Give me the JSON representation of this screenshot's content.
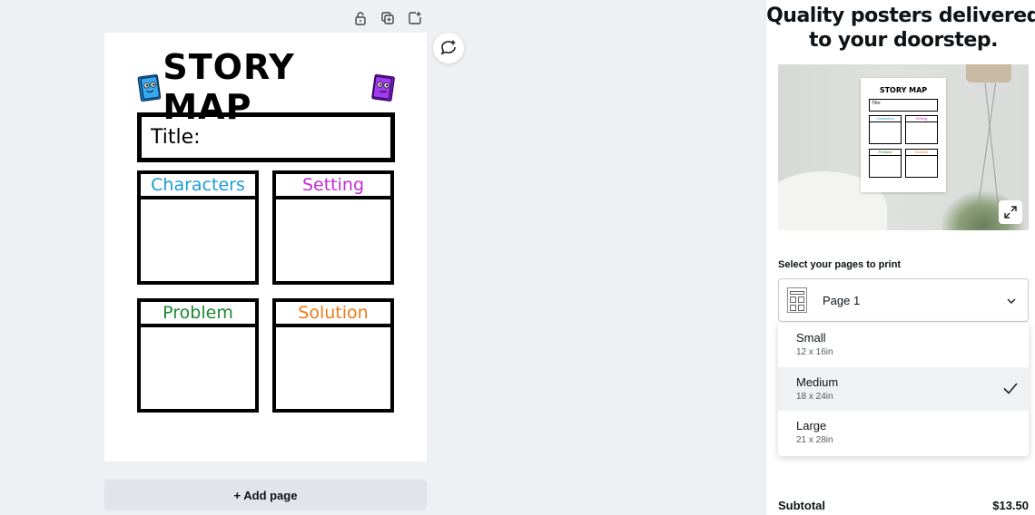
{
  "page": {
    "add_page_label": "+ Add page"
  },
  "story_map": {
    "heading": "STORY MAP",
    "title_label": "Title:",
    "cells": [
      {
        "label": "Characters",
        "color": "#1a9bd7"
      },
      {
        "label": "Setting",
        "color": "#c42bd6"
      },
      {
        "label": "Problem",
        "color": "#1a8a2e"
      },
      {
        "label": "Solution",
        "color": "#f07a1a"
      }
    ]
  },
  "icons": {
    "lock": "lock-icon",
    "duplicate": "duplicate-icon",
    "add_page": "add-page-icon",
    "comment": "add-comment-icon",
    "expand": "expand-icon",
    "chevron": "chevron-down-icon",
    "check": "check-icon"
  },
  "panel": {
    "heading_line1": "Quality posters delivered",
    "heading_line2": "to your doorstep.",
    "select_label": "Select your pages to print",
    "selected_page": "Page 1",
    "sizes": [
      {
        "name": "Small",
        "dims": "12 x 16in",
        "selected": false
      },
      {
        "name": "Medium",
        "dims": "18 x 24in",
        "selected": true
      },
      {
        "name": "Large",
        "dims": "21 x 28in",
        "selected": false
      }
    ],
    "subtotal_label": "Subtotal",
    "subtotal_value": "$13.50"
  },
  "preview_mini": {
    "title": "STORY MAP",
    "title_field": "Title:",
    "cells": [
      "Characters",
      "Setting",
      "Problem",
      "Solution"
    ]
  }
}
